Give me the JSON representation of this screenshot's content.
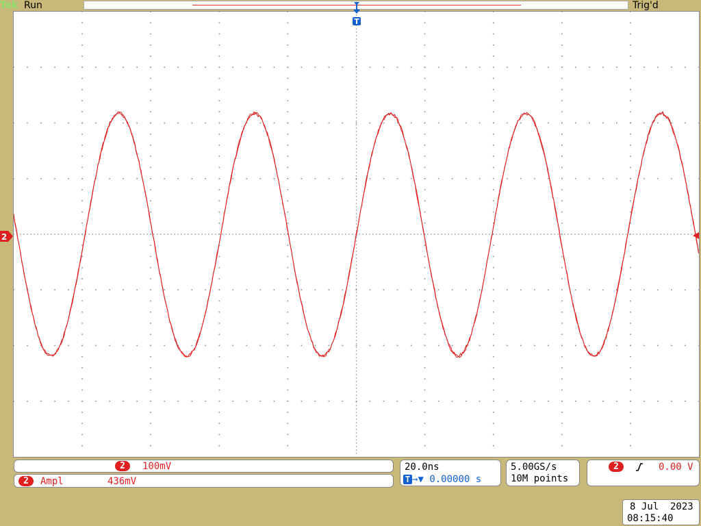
{
  "header": {
    "brand": "Tek",
    "run_state": "Run",
    "trigger_state": "Trig'd"
  },
  "markers": {
    "channel_marker": "2",
    "trigger_marker": "T"
  },
  "vertical": {
    "channel": "2",
    "scale": "100mV"
  },
  "measurement": {
    "channel": "2",
    "name": "Ampl",
    "value": "436mV"
  },
  "horizontal": {
    "scale": "20.0ns",
    "position": "0.00000 s"
  },
  "acquisition": {
    "sample_rate": "5.00GS/s",
    "record_length": "10M points"
  },
  "trigger": {
    "channel": "2",
    "slope_icon": "rising-edge-icon",
    "level": "0.00 V"
  },
  "datetime": {
    "date": "8 Jul  2023",
    "time": "08:15:40"
  },
  "colors": {
    "channel2": "#e02020",
    "trigger": "#1060d0",
    "bezel": "#c8b87a"
  },
  "chart_data": {
    "type": "line",
    "series": [
      {
        "channel": "2",
        "waveform": "sine",
        "amplitude_mV": 436,
        "period_ns": 39.6,
        "center_V": 0.0,
        "phase_at_trigger": "rising zero-crossing"
      }
    ],
    "x_divisions": 10,
    "y_divisions": 8,
    "x_per_div": "20.0ns",
    "y_per_div": "100mV",
    "grid": true
  }
}
